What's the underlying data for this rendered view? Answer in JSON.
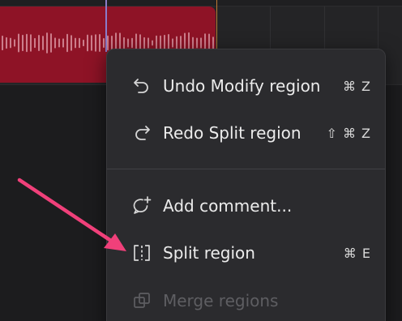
{
  "menu": {
    "items": [
      {
        "label": "Undo Modify region",
        "shortcut": "⌘ Z",
        "icon": "undo-icon",
        "enabled": true
      },
      {
        "label": "Redo Split region",
        "shortcut": "⇧ ⌘ Z",
        "icon": "redo-icon",
        "enabled": true
      },
      {
        "label": "Add comment...",
        "shortcut": "",
        "icon": "add-comment-icon",
        "enabled": true
      },
      {
        "label": "Split region",
        "shortcut": "⌘ E",
        "icon": "split-region-icon",
        "enabled": true
      },
      {
        "label": "Merge regions",
        "shortcut": "",
        "icon": "merge-regions-icon",
        "enabled": false
      }
    ]
  },
  "colors": {
    "region": "#8e1326",
    "menu_background": "#2b2b2e",
    "annotation_arrow": "#f0407a",
    "disabled_text": "#5e5e62"
  }
}
